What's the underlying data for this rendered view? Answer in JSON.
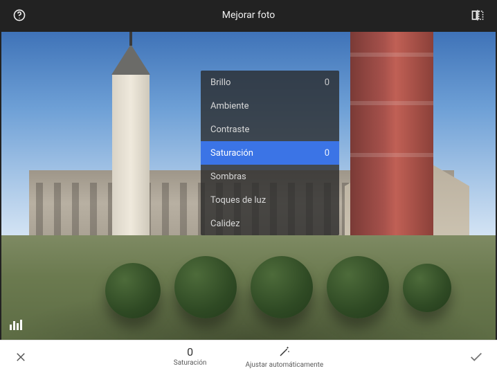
{
  "header": {
    "title": "Mejorar foto",
    "help_icon": "help-circle-icon",
    "compare_icon": "compare-icon"
  },
  "adjustments": {
    "items": [
      {
        "label": "Brillo",
        "value": "0",
        "selected": false
      },
      {
        "label": "Ambiente",
        "value": "",
        "selected": false
      },
      {
        "label": "Contraste",
        "value": "",
        "selected": false
      },
      {
        "label": "Saturación",
        "value": "0",
        "selected": true
      },
      {
        "label": "Sombras",
        "value": "",
        "selected": false
      },
      {
        "label": "Toques de luz",
        "value": "",
        "selected": false
      },
      {
        "label": "Calidez",
        "value": "",
        "selected": false
      }
    ]
  },
  "viewport": {
    "histogram_icon": "histogram-icon"
  },
  "bottombar": {
    "close_icon": "close-icon",
    "current_value": "0",
    "current_label": "Saturación",
    "auto_icon": "magic-wand-icon",
    "auto_label": "Ajustar automáticamente",
    "apply_icon": "check-icon"
  },
  "colors": {
    "accent": "#3b74e6",
    "bg_dark": "#222222"
  }
}
